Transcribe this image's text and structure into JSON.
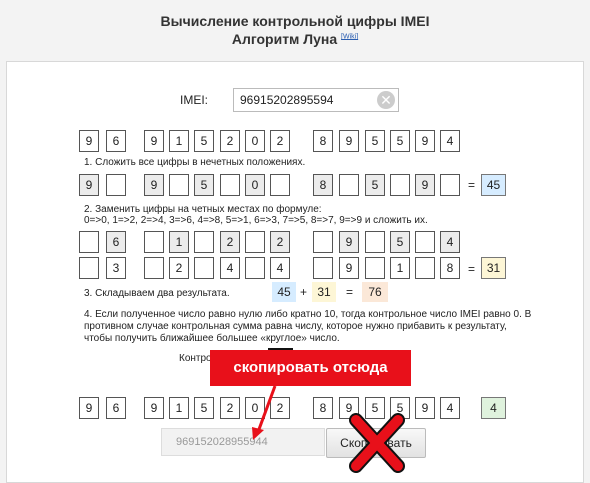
{
  "header": {
    "title": "Вычисление контрольной цифры IMEI",
    "subtitle": "Алгоритм Луна",
    "wiki_link": "[Wiki]"
  },
  "imei_field": {
    "label": "IMEI:",
    "value": "96915202895594",
    "clear_icon": "close-circle-icon"
  },
  "digits_row": {
    "digits": [
      "9",
      "6",
      "9",
      "1",
      "5",
      "2",
      "0",
      "2",
      "8",
      "9",
      "5",
      "5",
      "9",
      "4"
    ]
  },
  "step1": {
    "text": "1. Сложить все цифры в нечетных положениях.",
    "digits": [
      "9",
      "",
      "9",
      "",
      "5",
      "",
      "0",
      "",
      "8",
      "",
      "5",
      "",
      "9",
      ""
    ],
    "equals": "=",
    "result": "45"
  },
  "step2": {
    "text_line1": "2. Заменить цифры на четных местах по формуле:",
    "text_line2": "0=>0, 1=>2, 2=>4, 3=>6, 4=>8, 5=>1, 6=>3, 7=>5, 8=>7, 9=>9 и сложить их.",
    "row_original": [
      "",
      "6",
      "",
      "1",
      "",
      "2",
      "",
      "2",
      "",
      "9",
      "",
      "5",
      "",
      "4"
    ],
    "row_converted": [
      "",
      "3",
      "",
      "2",
      "",
      "4",
      "",
      "4",
      "",
      "9",
      "",
      "1",
      "",
      "8"
    ],
    "equals": "=",
    "result": "31"
  },
  "step3": {
    "text": "3. Складываем два результата.",
    "a": "45",
    "plus": "+",
    "b": "31",
    "equals": "=",
    "sum": "76"
  },
  "step4": {
    "line1": "4. Если полученное число равно нулю либо кратно 10, тогда контрольное число IMEI равно 0. В",
    "line2": "противном случае контрольная сумма равна числу, которое нужно прибавить к результату,",
    "line3": "чтобы получить ближайшее большее «круглое» число."
  },
  "check_label": "Контро",
  "final_row": {
    "digits": [
      "9",
      "6",
      "9",
      "1",
      "5",
      "2",
      "0",
      "2",
      "8",
      "9",
      "5",
      "5",
      "9",
      "4"
    ],
    "check_digit": "4"
  },
  "copy": {
    "value": "969152028955944",
    "button_label": "Скопировать"
  },
  "annotation": {
    "callout_text": "скопировать отсюда",
    "callout_color": "#e8101a",
    "cross_icon": "red-cross-icon"
  }
}
